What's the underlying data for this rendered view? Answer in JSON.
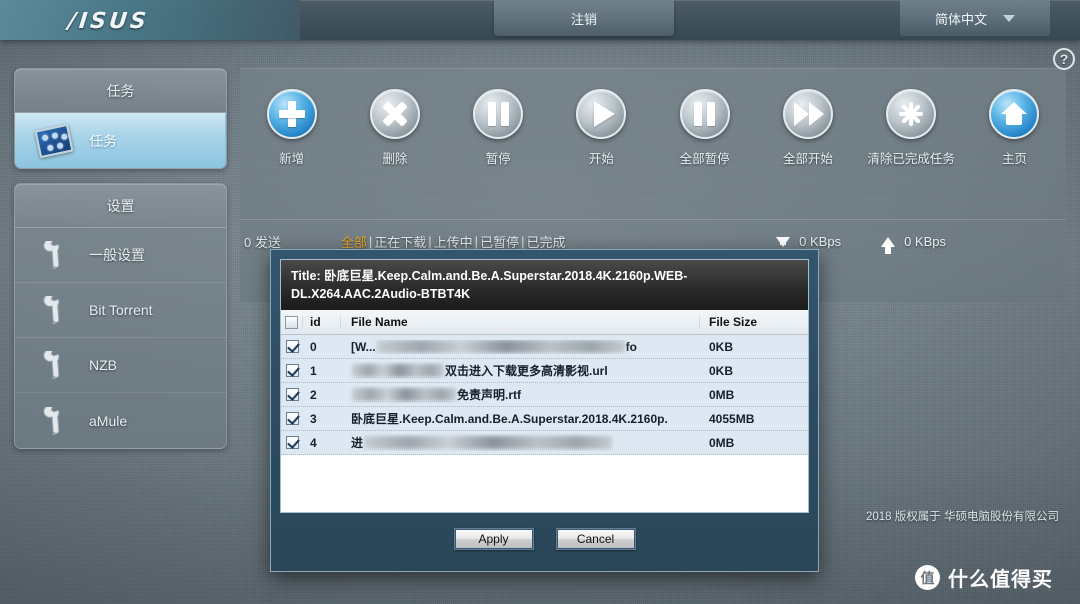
{
  "header": {
    "brand": "/ISUS",
    "logout_label": "注销",
    "language_label": "简体中文",
    "help_label": "?"
  },
  "sidebar": {
    "task_section": {
      "title": "任务",
      "items": [
        {
          "label": "任务",
          "icon": "task-grid-icon",
          "active": true
        }
      ]
    },
    "settings_section": {
      "title": "设置",
      "items": [
        {
          "label": "一般设置",
          "icon": "wrench-icon"
        },
        {
          "label": "Bit Torrent",
          "icon": "wrench-icon"
        },
        {
          "label": "NZB",
          "icon": "wrench-icon"
        },
        {
          "label": "aMule",
          "icon": "wrench-icon"
        }
      ]
    }
  },
  "toolbar": {
    "buttons": [
      {
        "label": "新增",
        "icon": "plus-icon",
        "accent": true
      },
      {
        "label": "删除",
        "icon": "close-x-icon",
        "accent": false
      },
      {
        "label": "暂停",
        "icon": "pause-icon",
        "accent": false
      },
      {
        "label": "开始",
        "icon": "play-icon",
        "accent": false
      },
      {
        "label": "全部暂停",
        "icon": "pause-all-icon",
        "accent": false
      },
      {
        "label": "全部开始",
        "icon": "fast-forward-icon",
        "accent": false
      },
      {
        "label": "清除已完成任务",
        "icon": "burst-clear-icon",
        "accent": false
      },
      {
        "label": "主页",
        "icon": "home-icon",
        "accent": true
      }
    ]
  },
  "status": {
    "send_count": "0 发送",
    "filters": [
      {
        "label": "全部",
        "active": true
      },
      {
        "label": "正在下载",
        "active": false
      },
      {
        "label": "上传中",
        "active": false
      },
      {
        "label": "已暂停",
        "active": false
      },
      {
        "label": "已完成",
        "active": false
      }
    ],
    "separator": "|",
    "download_speed": "0 KBps",
    "upload_speed": "0 KBps",
    "active_filter_color": "#f0a825"
  },
  "dialog": {
    "title": "Title:  卧底巨星.Keep.Calm.and.Be.A.Superstar.2018.4K.2160p.WEB-DL.X264.AAC.2Audio-BTBT4K",
    "columns": {
      "id": "id",
      "file_name": "File Name",
      "file_size": "File Size"
    },
    "rows": [
      {
        "id": "0",
        "name_prefix": "[W...",
        "name_suffix": "fo",
        "file_size": "0KB",
        "checked": true,
        "redacted": true
      },
      {
        "id": "1",
        "name_prefix": "",
        "name_suffix": "双击进入下载更多高清影视.url",
        "file_size": "0KB",
        "checked": true,
        "redacted": true
      },
      {
        "id": "2",
        "name_prefix": "",
        "name_suffix": "免责声明.rtf",
        "file_size": "0MB",
        "checked": true,
        "redacted": true
      },
      {
        "id": "3",
        "name_prefix": "卧底巨星.Keep.Calm.and.Be.A.Superstar.2018.4K.2160p.",
        "name_suffix": "",
        "file_size": "4055MB",
        "checked": true,
        "redacted": false
      },
      {
        "id": "4",
        "name_prefix": "进",
        "name_suffix": "",
        "file_size": "0MB",
        "checked": true,
        "redacted": true
      }
    ],
    "apply_label": "Apply",
    "cancel_label": "Cancel"
  },
  "footer": {
    "copyright": "2018 版权属于  华硕电脑股份有限公司",
    "watermark_badge": "值",
    "watermark_text": "什么值得买"
  }
}
